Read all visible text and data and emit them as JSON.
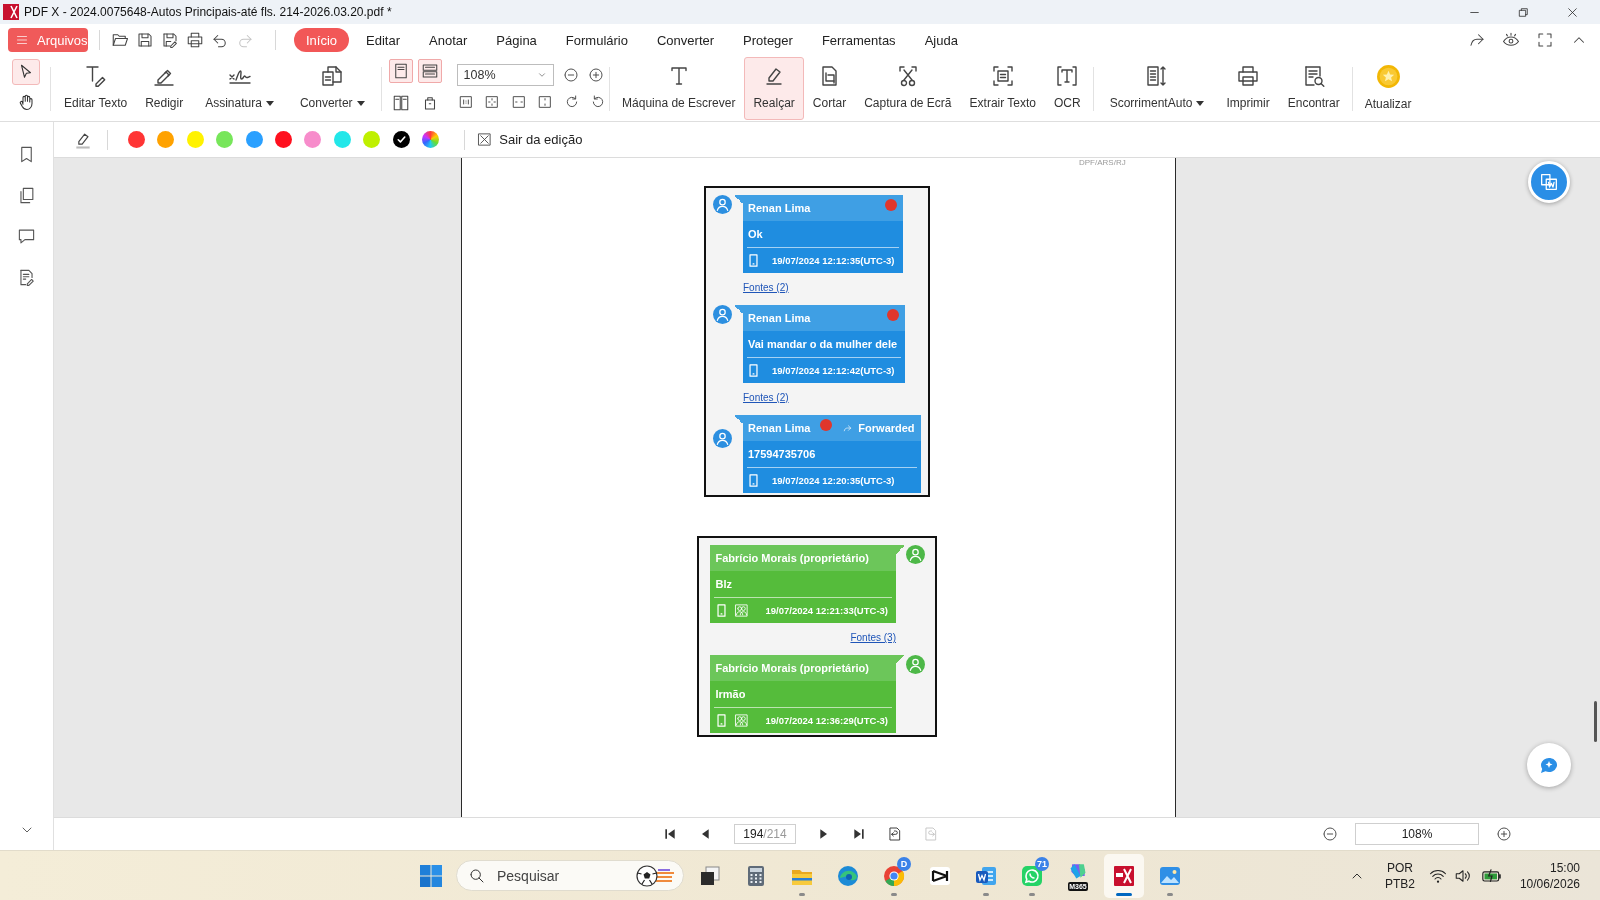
{
  "window": {
    "title": "PDF X - 2024.0075648-Autos Principais-até fls. 214-2026.03.20.pdf *"
  },
  "menu": {
    "file_button": "Arquivos",
    "quick_actions": [
      {
        "kind": "open",
        "disabled": false
      },
      {
        "kind": "save",
        "disabled": false
      },
      {
        "kind": "save-as",
        "disabled": false
      },
      {
        "kind": "print",
        "disabled": false
      },
      {
        "kind": "undo",
        "disabled": false
      },
      {
        "kind": "redo",
        "disabled": true
      }
    ],
    "tabs": [
      {
        "label": "Início",
        "selected": true
      },
      {
        "label": "Editar",
        "selected": false
      },
      {
        "label": "Anotar",
        "selected": false
      },
      {
        "label": "Página",
        "selected": false
      },
      {
        "label": "Formulário",
        "selected": false
      },
      {
        "label": "Converter",
        "selected": false
      },
      {
        "label": "Proteger",
        "selected": false
      },
      {
        "label": "Ferramentas",
        "selected": false
      },
      {
        "label": "Ajuda",
        "selected": false
      }
    ]
  },
  "toolbar": {
    "pointer_tools": [
      {
        "kind": "select",
        "selected": true
      },
      {
        "kind": "hand",
        "selected": false
      }
    ],
    "edit_tools": [
      {
        "kind": "edit-text",
        "label": "Editar Texto",
        "dropdown": false,
        "selected": false
      },
      {
        "kind": "redact",
        "label": "Redigir",
        "dropdown": false,
        "selected": false
      },
      {
        "kind": "signature",
        "label": "Assinatura",
        "dropdown": true,
        "selected": false
      },
      {
        "kind": "convert",
        "label": "Converter",
        "dropdown": true,
        "selected": false
      }
    ],
    "view": {
      "layouts": [
        {
          "kind": "single",
          "selected": true
        },
        {
          "kind": "continuous",
          "selected": true
        },
        {
          "kind": "facing",
          "selected": false
        },
        {
          "kind": "cover",
          "selected": false
        }
      ],
      "zoom": "108%"
    },
    "annotate_tools": [
      {
        "kind": "typewriter",
        "label": "Máquina de Escrever",
        "dropdown": false,
        "selected": false
      },
      {
        "kind": "highlight",
        "label": "Realçar",
        "dropdown": false,
        "selected": true
      },
      {
        "kind": "crop",
        "label": "Cortar",
        "dropdown": false,
        "selected": false
      },
      {
        "kind": "screenshot",
        "label": "Captura de Ecrã",
        "dropdown": false,
        "selected": false
      },
      {
        "kind": "extract-text",
        "label": "Extrair Texto",
        "dropdown": false,
        "selected": false
      },
      {
        "kind": "ocr",
        "label": "OCR",
        "dropdown": false,
        "selected": false
      }
    ],
    "page_tools": [
      {
        "kind": "auto-scroll",
        "label": "ScorrimentAuto",
        "dropdown": true,
        "selected": false
      },
      {
        "kind": "print",
        "label": "Imprimir",
        "dropdown": false,
        "selected": false
      },
      {
        "kind": "find",
        "label": "Encontrar",
        "dropdown": false,
        "selected": false
      }
    ],
    "extra_tools": [
      {
        "kind": "update",
        "label": "Atualizar",
        "dropdown": false,
        "selected": false
      }
    ]
  },
  "highlight_bar": {
    "swatches": [
      {
        "color": "#ff3535",
        "selected": false
      },
      {
        "color": "#ffa200",
        "selected": false
      },
      {
        "color": "#fff200",
        "selected": false
      },
      {
        "color": "#77e65a",
        "selected": false
      },
      {
        "color": "#2aa0ff",
        "selected": false
      },
      {
        "color": "#ff101e",
        "selected": false
      },
      {
        "color": "#f78ccb",
        "selected": false
      },
      {
        "color": "#22e7e9",
        "selected": false
      },
      {
        "color": "#bff000",
        "selected": false
      },
      {
        "color": "#000000",
        "selected": true
      }
    ],
    "exit_label": "Sair da edição"
  },
  "document": {
    "header_fragment": "DPF/ARS/RJ",
    "chats": [
      {
        "messages": [
          {
            "kind": "incoming",
            "sender": "Renan Lima",
            "flagged": true,
            "text": "Ok",
            "time": "19/07/2024 12:12:35(UTC-3)",
            "sources": "Fontes (2)"
          },
          {
            "kind": "incoming",
            "sender": "Renan Lima",
            "flagged": true,
            "text": "Vai mandar o da mulher dele",
            "time": "19/07/2024 12:12:42(UTC-3)",
            "sources": "Fontes (2)"
          },
          {
            "kind": "incoming",
            "sender": "Renan Lima",
            "flagged": true,
            "forwarded": "Forwarded",
            "text": "17594735706",
            "time": "19/07/2024 12:20:35(UTC-3)"
          }
        ]
      },
      {
        "messages": [
          {
            "kind": "outgoing",
            "sender": "Fabrício Morais (proprietário)",
            "flagged": false,
            "text": "Blz",
            "time": "19/07/2024 12:21:33(UTC-3)",
            "sources": "Fontes (3)"
          },
          {
            "kind": "outgoing",
            "sender": "Fabrício Morais (proprietário)",
            "flagged": false,
            "text": "Irmão",
            "time": "19/07/2024 12:36:29(UTC-3)"
          }
        ]
      }
    ]
  },
  "page_nav": {
    "buttons": [
      {
        "kind": "first",
        "disabled": false
      },
      {
        "kind": "previous",
        "disabled": false
      },
      {
        "kind": "next",
        "disabled": false
      },
      {
        "kind": "last",
        "disabled": false
      },
      {
        "kind": "view-back",
        "disabled": false
      },
      {
        "kind": "view-forward",
        "disabled": true
      }
    ],
    "page": "194",
    "total": "/214",
    "zoom": "108%"
  },
  "taskbar": {
    "search_placeholder": "Pesquisar",
    "apps": [
      {
        "kind": "task-view",
        "running": false,
        "active": false
      },
      {
        "kind": "calculator",
        "running": false,
        "active": false
      },
      {
        "kind": "explorer",
        "running": true,
        "active": false
      },
      {
        "kind": "edge",
        "running": false,
        "active": false
      },
      {
        "kind": "chrome",
        "running": true,
        "active": false,
        "badge": "D"
      },
      {
        "kind": "capcut",
        "running": false,
        "active": false
      },
      {
        "kind": "word",
        "running": true,
        "active": false
      },
      {
        "kind": "whatsapp",
        "running": true,
        "active": false,
        "badge": "71"
      },
      {
        "kind": "m365",
        "running": false,
        "active": false,
        "label": "M365"
      },
      {
        "kind": "pdfx",
        "running": true,
        "active": true
      },
      {
        "kind": "photos",
        "running": true,
        "active": false
      }
    ],
    "tray": {
      "language": "POR",
      "layout": "PTB2",
      "time": "15:00",
      "date": "10/06/2026"
    }
  }
}
